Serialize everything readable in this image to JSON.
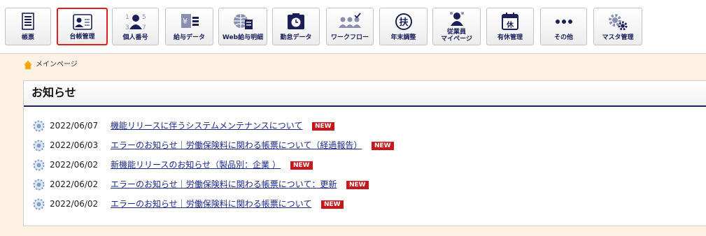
{
  "toolbar": {
    "items": [
      {
        "id": "chohyo",
        "label": "帳票",
        "icon": "document-list-icon"
      },
      {
        "id": "daicho",
        "label": "台帳管理",
        "icon": "id-card-icon",
        "active": true
      },
      {
        "id": "kojin",
        "label": "個人番号",
        "icon": "my-number-icon"
      },
      {
        "id": "kyuyo",
        "label": "給与データ",
        "icon": "payroll-data-icon"
      },
      {
        "id": "web",
        "label": "Web給与明細",
        "icon": "web-payslip-icon"
      },
      {
        "id": "kintai",
        "label": "勤怠データ",
        "icon": "timecard-icon"
      },
      {
        "id": "workflow",
        "label": "ワークフロー",
        "icon": "workflow-icon"
      },
      {
        "id": "nenmatsu",
        "label": "年末調整",
        "icon": "fu-seal-icon"
      },
      {
        "id": "mypage",
        "label_line1": "従業員",
        "label_line2": "マイページ",
        "icon": "employee-icon"
      },
      {
        "id": "yukyu",
        "label": "有休管理",
        "icon": "calendar-holiday-icon"
      },
      {
        "id": "other",
        "label": "その他",
        "icon": "more-dots-icon"
      },
      {
        "id": "master",
        "label": "マスタ管理",
        "icon": "gear-settings-icon"
      }
    ],
    "numbers_icon_text": [
      "1",
      "5",
      "3",
      "7"
    ],
    "yen_icon_text": "¥",
    "holiday_icon_text": "休",
    "fu_icon_text": "扶"
  },
  "breadcrumb": {
    "home": "メインページ"
  },
  "notice": {
    "title": "お知らせ",
    "items": [
      {
        "date": "2022/06/07",
        "text": "機能リリースに伴うシステムメンテナンスについて",
        "badge": "NEW"
      },
      {
        "date": "2022/06/03",
        "text": "エラーのお知らせ｜労働保険料に関わる帳票について（経過報告）",
        "badge": "NEW"
      },
      {
        "date": "2022/06/02",
        "text": "新機能リリースのお知らせ（製品別：企業 ）",
        "badge": "NEW"
      },
      {
        "date": "2022/06/02",
        "text": "エラーのお知らせ｜労働保険料に関わる帳票について：更新",
        "badge": "NEW"
      },
      {
        "date": "2022/06/02",
        "text": "エラーのお知らせ｜労働保険料に関わる帳票について",
        "badge": "NEW"
      }
    ]
  },
  "colors": {
    "navy": "#1a1f5a",
    "accent_red": "#e02020",
    "badge_red": "#c8161d",
    "background": "#fdf1e4"
  }
}
